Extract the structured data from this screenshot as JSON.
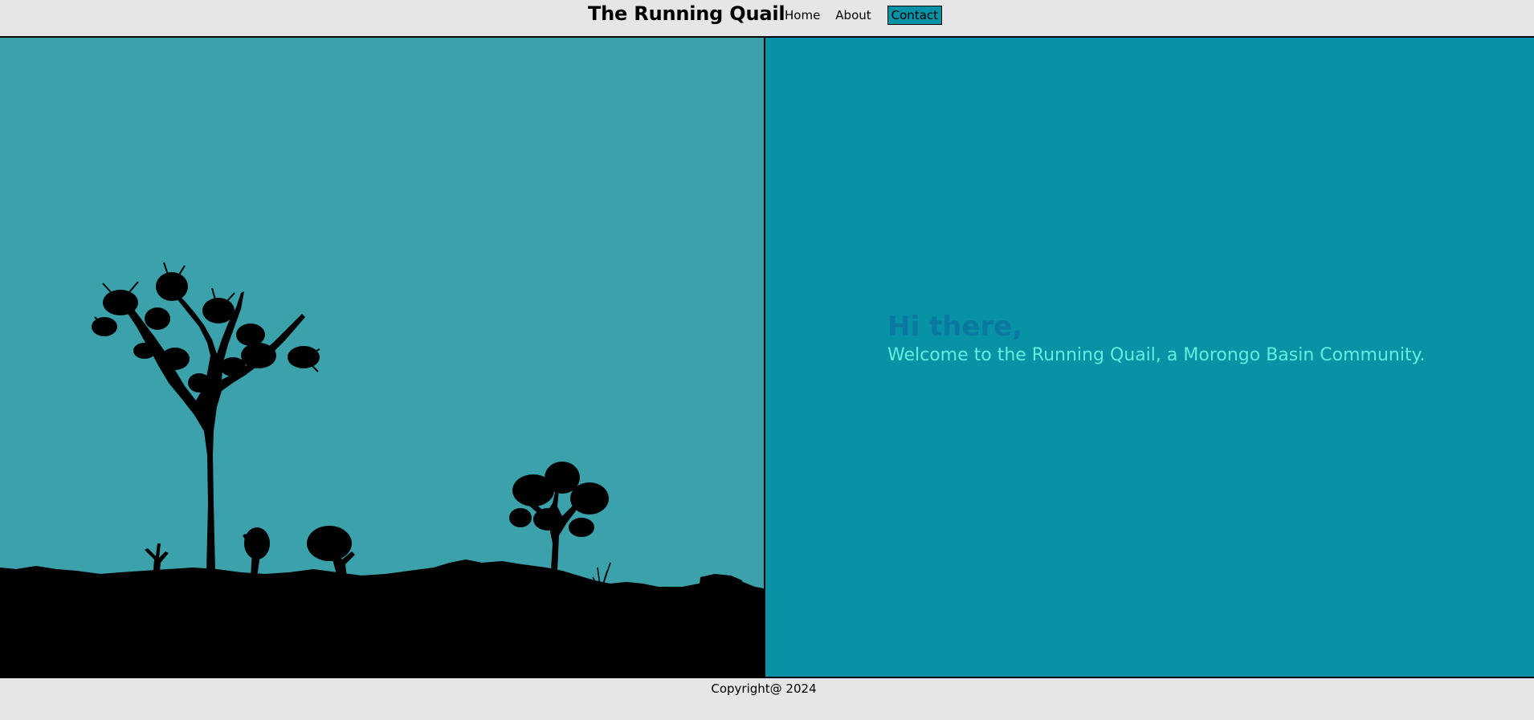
{
  "header": {
    "site_title": "The Running Quail",
    "nav": {
      "home": "Home",
      "about": "About",
      "contact": "Contact"
    }
  },
  "main": {
    "greeting": "Hi there,",
    "welcome": "Welcome to the Running Quail, a Morongo Basin Community."
  },
  "footer": {
    "copyright": "Copyright@ 2024"
  },
  "colors": {
    "page_bg": "#e6e6e6",
    "left_panel_bg": "#3ba2ab",
    "right_panel_bg": "#0892a5",
    "greeting": "#0a78a0",
    "welcome_text": "#5ef0dd",
    "silhouette": "#000000"
  }
}
